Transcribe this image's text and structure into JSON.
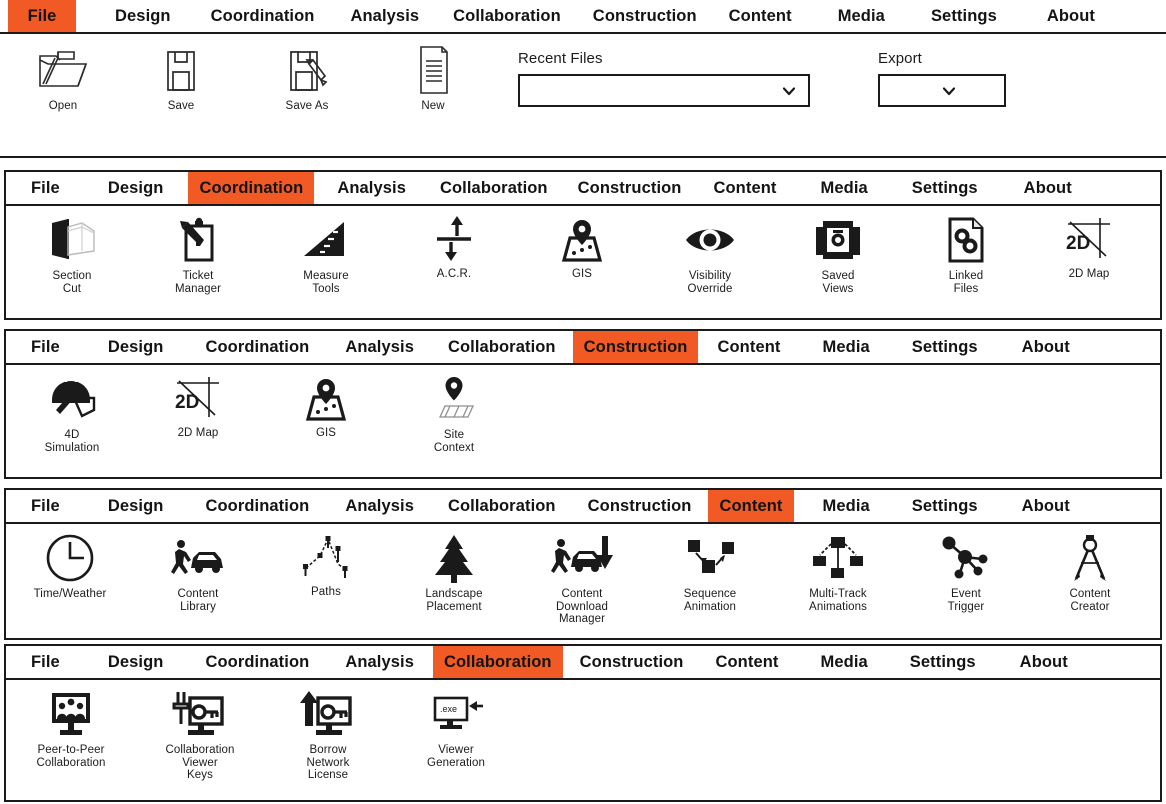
{
  "theme": {
    "accent": "#f15a24",
    "ink": "#1a1a1a",
    "paper": "#ffffff"
  },
  "menu": {
    "items": [
      "File",
      "Design",
      "Coordination",
      "Analysis",
      "Collaboration",
      "Construction",
      "Content",
      "Media",
      "Settings",
      "About"
    ]
  },
  "panels": [
    {
      "id": "file",
      "active_tab": "File",
      "tools": [
        {
          "label": "Open",
          "icon": "open-folder-icon"
        },
        {
          "label": "Save",
          "icon": "floppy-disk-icon"
        },
        {
          "label": "Save As",
          "icon": "floppy-disk-pen-icon"
        },
        {
          "label": "New",
          "icon": "document-lines-icon"
        }
      ],
      "fields": [
        {
          "name": "recent-files",
          "label": "Recent Files",
          "value": "",
          "icon": "chevron-down-icon"
        },
        {
          "name": "export",
          "label": "Export",
          "value": "",
          "icon": "chevron-down-icon"
        }
      ]
    },
    {
      "id": "coordination",
      "active_tab": "Coordination",
      "tools": [
        {
          "label": "Section\nCut",
          "icon": "section-cut-icon"
        },
        {
          "label": "Ticket\nManager",
          "icon": "clipboard-pencil-icon"
        },
        {
          "label": "Measure\nTools",
          "icon": "ruler-triangle-icon"
        },
        {
          "label": "A.C.R.",
          "icon": "up-down-arrows-icon"
        },
        {
          "label": "GIS",
          "icon": "map-pin-area-icon"
        },
        {
          "label": "Visibility\nOverride",
          "icon": "eye-icon"
        },
        {
          "label": "Saved\nViews",
          "icon": "camera-photos-icon"
        },
        {
          "label": "Linked\nFiles",
          "icon": "linked-document-icon"
        },
        {
          "label": "2D Map",
          "icon": "two-d-map-icon"
        }
      ]
    },
    {
      "id": "construction",
      "active_tab": "Construction",
      "tools": [
        {
          "label": "4D\nSimulation",
          "icon": "hardhat-trowel-icon"
        },
        {
          "label": "2D Map",
          "icon": "two-d-map-icon"
        },
        {
          "label": "GIS",
          "icon": "map-pin-area-icon"
        },
        {
          "label": "Site\nContext",
          "icon": "pin-grid-icon"
        }
      ]
    },
    {
      "id": "content",
      "active_tab": "Content",
      "tools": [
        {
          "label": "Time/Weather",
          "icon": "clock-icon"
        },
        {
          "label": "Content\nLibrary",
          "icon": "person-car-icon"
        },
        {
          "label": "Paths",
          "icon": "path-nodes-icon"
        },
        {
          "label": "Landscape\nPlacement",
          "icon": "pine-tree-icon"
        },
        {
          "label": "Content\nDownload\nManager",
          "icon": "person-car-download-icon"
        },
        {
          "label": "Sequence\nAnimation",
          "icon": "sequence-nodes-icon"
        },
        {
          "label": "Multi-Track\nAnimations",
          "icon": "multitrack-tree-icon"
        },
        {
          "label": "Event\nTrigger",
          "icon": "event-network-icon"
        },
        {
          "label": "Content\nCreator",
          "icon": "compass-divider-icon"
        }
      ]
    },
    {
      "id": "collaboration",
      "active_tab": "Collaboration",
      "tools": [
        {
          "label": "Peer-to-Peer\nCollaboration",
          "icon": "monitor-people-icon"
        },
        {
          "label": "Collaboration\nViewer\nKeys",
          "icon": "monitor-key-icon"
        },
        {
          "label": "Borrow\nNetwork\nLicense",
          "icon": "monitor-key-uparrow-icon"
        },
        {
          "label": "Viewer\nGeneration",
          "icon": "monitor-exe-icon"
        }
      ]
    }
  ]
}
